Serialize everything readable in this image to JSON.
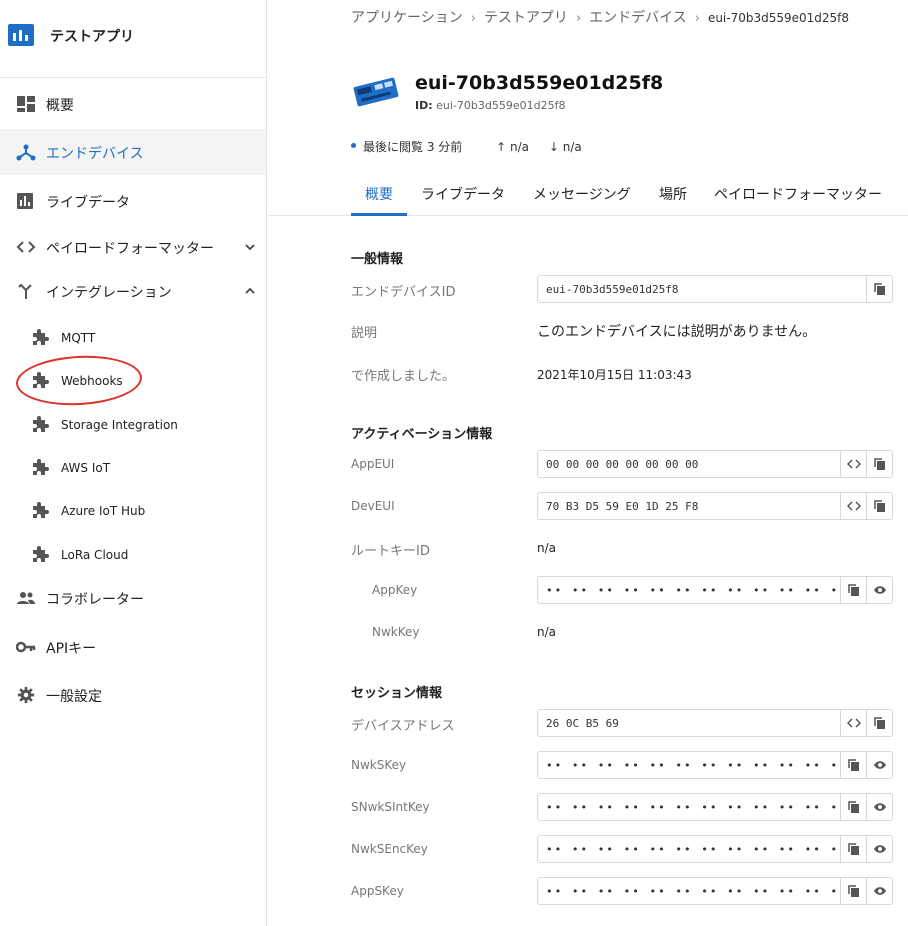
{
  "app": {
    "name": "テストアプリ"
  },
  "sidebar": {
    "items": [
      {
        "label": "概要",
        "icon": "dashboard-icon"
      },
      {
        "label": "エンドデバイス",
        "icon": "device-hub-icon"
      },
      {
        "label": "ライブデータ",
        "icon": "bar-chart-icon"
      },
      {
        "label": "ペイロードフォーマッター",
        "icon": "code-icon"
      },
      {
        "label": "インテグレーション",
        "icon": "merge-icon"
      },
      {
        "label": "コラボレーター",
        "icon": "people-icon"
      },
      {
        "label": "APIキー",
        "icon": "key-icon"
      },
      {
        "label": "一般設定",
        "icon": "gear-icon"
      }
    ],
    "integrations": [
      {
        "label": "MQTT"
      },
      {
        "label": "Webhooks"
      },
      {
        "label": "Storage Integration"
      },
      {
        "label": "AWS IoT"
      },
      {
        "label": "Azure IoT Hub"
      },
      {
        "label": "LoRa Cloud"
      }
    ]
  },
  "breadcrumb": [
    "アプリケーション",
    "テストアプリ",
    "エンドデバイス",
    "eui-70b3d559e01d25f8"
  ],
  "device": {
    "title": "eui-70b3d559e01d25f8",
    "id_label": "ID:",
    "id_value": "eui-70b3d559e01d25f8",
    "last_seen": "最後に閲覧 3 分前",
    "up": "n/a",
    "down": "n/a"
  },
  "tabs": [
    "概要",
    "ライブデータ",
    "メッセージング",
    "場所",
    "ペイロードフォーマッター"
  ],
  "general": {
    "title": "一般情報",
    "device_id_label": "エンドデバイスID",
    "device_id_value": "eui-70b3d559e01d25f8",
    "description_label": "説明",
    "description_value": "このエンドデバイスには説明がありません。",
    "created_label": "で作成しました。",
    "created_value": "2021年10月15日 11:03:43"
  },
  "activation": {
    "title": "アクティベーション情報",
    "appeui_label": "AppEUI",
    "appeui_value": "00 00 00 00 00 00 00 00",
    "deveui_label": "DevEUI",
    "deveui_value": "70 B3 D5 59 E0 1D 25 F8",
    "rootkey_label": "ルートキーID",
    "rootkey_value": "n/a",
    "appkey_label": "AppKey",
    "appkey_value": "•• •• •• •• •• •• •• •• •• •• •• •• •• •• •• ••",
    "nwkkey_label": "NwkKey",
    "nwkkey_value": "n/a"
  },
  "session": {
    "title": "セッション情報",
    "devaddr_label": "デバイスアドレス",
    "devaddr_value": "26 0C B5 69",
    "nwkskey_label": "NwkSKey",
    "nwkskey_value": "•• •• •• •• •• •• •• •• •• •• •• •• •• •• •• ••",
    "snwksintkey_label": "SNwkSIntKey",
    "snwksintkey_value": "•• •• •• •• •• •• •• •• •• •• •• •• •• •• •• ••",
    "nwksenckey_label": "NwkSEncKey",
    "nwksenckey_value": "•• •• •• •• •• •• •• •• •• •• •• •• •• •• •• ••",
    "appskey_label": "AppSKey",
    "appskey_value": "•• •• •• •• •• •• •• •• •• •• •• •• •• •• •• ••"
  },
  "colors": {
    "accent": "#1e6ec8",
    "annotation": "#e0302a"
  }
}
